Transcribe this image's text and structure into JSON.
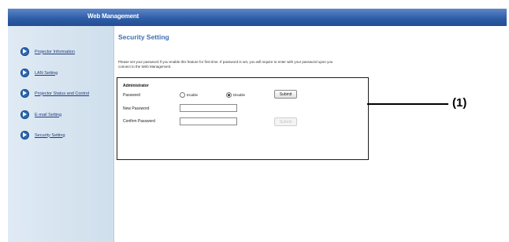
{
  "window": {
    "title": "Web Management"
  },
  "sidebar": {
    "items": [
      {
        "label": "Projector Information"
      },
      {
        "label": "LAN Setting"
      },
      {
        "label": "Projector Status and Control"
      },
      {
        "label": "E-mail Setting"
      },
      {
        "label": "Security Setting"
      }
    ]
  },
  "main": {
    "heading": "Security Setting",
    "description": "Please set your password if you enable this feature for first time. If password is set, you will require to enter with your password upon you connect to the Web Management.",
    "panel": {
      "title": "Administrator",
      "password_label": "Password",
      "enable_label": "Enable",
      "disable_label": "Disable",
      "selected": "Disable",
      "submit_label": "Submit",
      "new_password_label": "New Password",
      "new_password_value": "",
      "confirm_password_label": "Confirm Password",
      "confirm_password_value": "",
      "submit2_label": "Submit"
    }
  },
  "callout": {
    "label": "(1)"
  }
}
